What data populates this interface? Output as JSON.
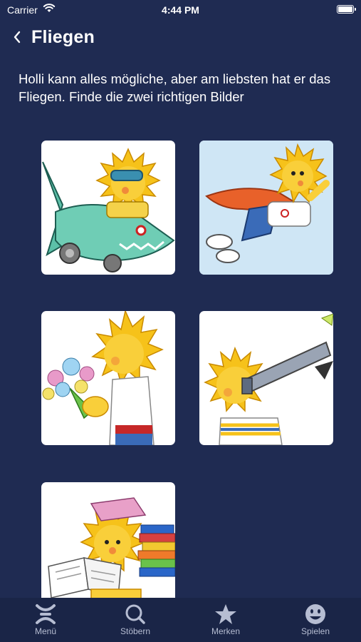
{
  "status": {
    "carrier": "Carrier",
    "time": "4:44 PM"
  },
  "nav": {
    "title": "Fliegen"
  },
  "prompt": "Holli kann alles mögliche, aber am liebsten hat er das Fliegen. Finde die zwei richtigen Bilder",
  "tiles": [
    {
      "icon": "holli-shark-plane-image"
    },
    {
      "icon": "holli-superhero-flying-image"
    },
    {
      "icon": "holli-flowers-image"
    },
    {
      "icon": "holli-telescope-image"
    },
    {
      "icon": "holli-books-image"
    }
  ],
  "tabbar": {
    "items": [
      {
        "label": "Menü",
        "icon": "menu-icon"
      },
      {
        "label": "Stöbern",
        "icon": "search-icon"
      },
      {
        "label": "Merken",
        "icon": "star-icon"
      },
      {
        "label": "Spielen",
        "icon": "smiley-icon"
      }
    ]
  },
  "colors": {
    "background": "#1f2b52",
    "tabbar": "#1a2547",
    "tab_inactive": "#b6bdd2",
    "holli_yellow": "#f6c21a"
  }
}
